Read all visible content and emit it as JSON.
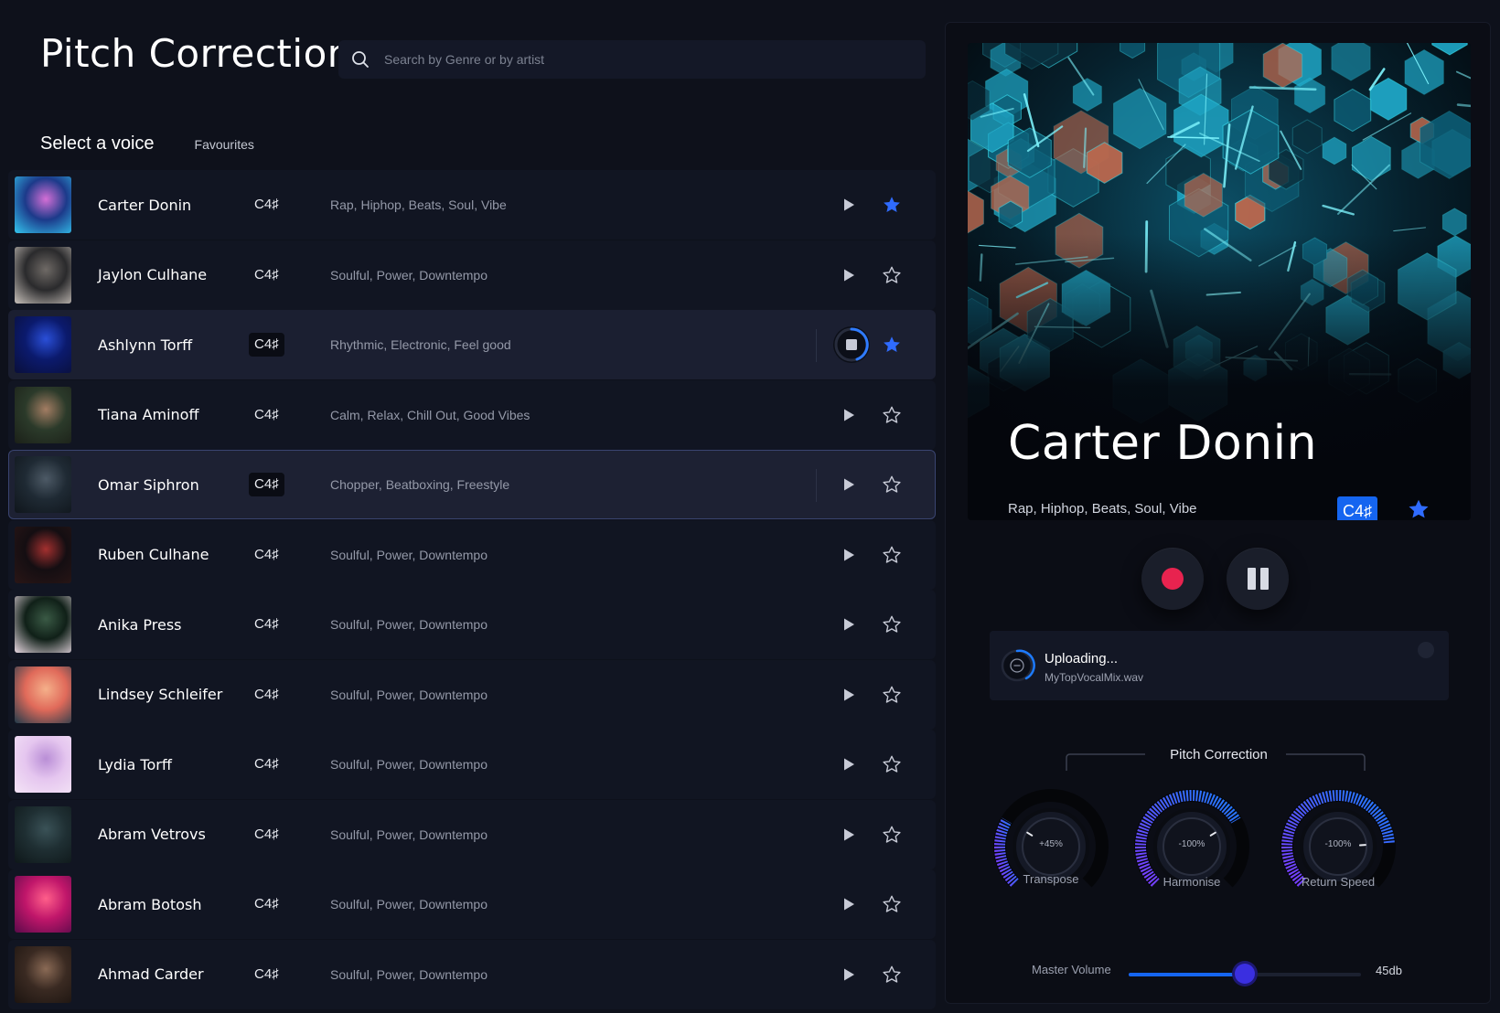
{
  "header": {
    "title": "Pitch Correction",
    "search_placeholder": "Search by Genre or by artist"
  },
  "list_header": {
    "title": "Select a voice",
    "favourites_tab": "Favourites"
  },
  "voices": [
    {
      "name": "Carter Donin",
      "key": "C4♯",
      "tags": "Rap, Hiphop, Beats, Soul, Vibe",
      "favourite": true,
      "state": "idle",
      "thumb": [
        "#1c3a8a",
        "#d46fd6",
        "#34c6ef"
      ]
    },
    {
      "name": "Jaylon Culhane",
      "key": "C4♯",
      "tags": "Soulful, Power, Downtempo",
      "favourite": false,
      "state": "idle",
      "thumb": [
        "#2a2a2c",
        "#6f6a66",
        "#c9c2bc"
      ]
    },
    {
      "name": "Ashlynn Torff",
      "key": "C4♯",
      "tags": "Rhythmic, Electronic, Feel good",
      "favourite": true,
      "state": "playing",
      "thumb": [
        "#0b1a6d",
        "#2a4fd8",
        "#0a0f3a"
      ]
    },
    {
      "name": "Tiana Aminoff",
      "key": "C4♯",
      "tags": "Calm, Relax, Chill Out, Good Vibes",
      "favourite": false,
      "state": "idle",
      "thumb": [
        "#2b3a2a",
        "#a37d63",
        "#1b2018"
      ]
    },
    {
      "name": "Omar Siphron",
      "key": "C4♯",
      "tags": "Chopper, Beatboxing, Freestyle",
      "favourite": false,
      "state": "selected",
      "thumb": [
        "#1f2a34",
        "#4d5a66",
        "#0f151b"
      ]
    },
    {
      "name": "Ruben Culhane",
      "key": "C4♯",
      "tags": "Soulful, Power, Downtempo",
      "favourite": false,
      "state": "idle",
      "thumb": [
        "#140e12",
        "#a3302f",
        "#2a1616"
      ]
    },
    {
      "name": "Anika Press",
      "key": "C4♯",
      "tags": "Soulful, Power, Downtempo",
      "favourite": false,
      "state": "idle",
      "thumb": [
        "#102018",
        "#3a5a45",
        "#e8d8e2"
      ]
    },
    {
      "name": "Lindsey Schleifer",
      "key": "C4♯",
      "tags": "Soulful, Power, Downtempo",
      "favourite": false,
      "state": "idle",
      "thumb": [
        "#e06a5a",
        "#f5b08a",
        "#1f3a4a"
      ]
    },
    {
      "name": "Lydia Torff",
      "key": "C4♯",
      "tags": "Soulful, Power, Downtempo",
      "favourite": false,
      "state": "idle",
      "thumb": [
        "#e5c6ef",
        "#b98ed6",
        "#f4e4f6"
      ]
    },
    {
      "name": "Abram Vetrovs",
      "key": "C4♯",
      "tags": "Soulful, Power, Downtempo",
      "favourite": false,
      "state": "idle",
      "thumb": [
        "#1f2f33",
        "#3a5257",
        "#0e1719"
      ]
    },
    {
      "name": "Abram Botosh",
      "key": "C4♯",
      "tags": "Soulful, Power, Downtempo",
      "favourite": false,
      "state": "idle",
      "thumb": [
        "#c0166a",
        "#ff5f8a",
        "#5a0a4a"
      ]
    },
    {
      "name": "Ahmad Carder",
      "key": "C4♯",
      "tags": "Soulful, Power, Downtempo",
      "favourite": false,
      "state": "idle",
      "thumb": [
        "#3a2a22",
        "#8a6a55",
        "#1c1410"
      ]
    }
  ],
  "now_playing": {
    "name": "Carter Donin",
    "tags": "Rap, Hiphop, Beats, Soul, Vibe",
    "key": "C4♯",
    "favourite": true
  },
  "transport": {
    "record_icon": "record-icon",
    "pause_icon": "pause-icon"
  },
  "upload": {
    "title": "Uploading...",
    "file": "MyTopVocalMix.wav"
  },
  "pitch_correction": {
    "title": "Pitch Correction",
    "knobs": [
      {
        "label": "Transpose",
        "value_text": "+45%",
        "value": 0.28
      },
      {
        "label": "Harmonise",
        "value_text": "-100%",
        "value": 0.72
      },
      {
        "label": "Return Speed",
        "value_text": "-100%",
        "value": 0.82
      }
    ]
  },
  "master_volume": {
    "label": "Master Volume",
    "value_text": "45db",
    "level": 0.5
  },
  "colors": {
    "accent": "#1565f0",
    "star_active": "#2f6bff",
    "record": "#e8234f",
    "background": "#0e111b"
  }
}
